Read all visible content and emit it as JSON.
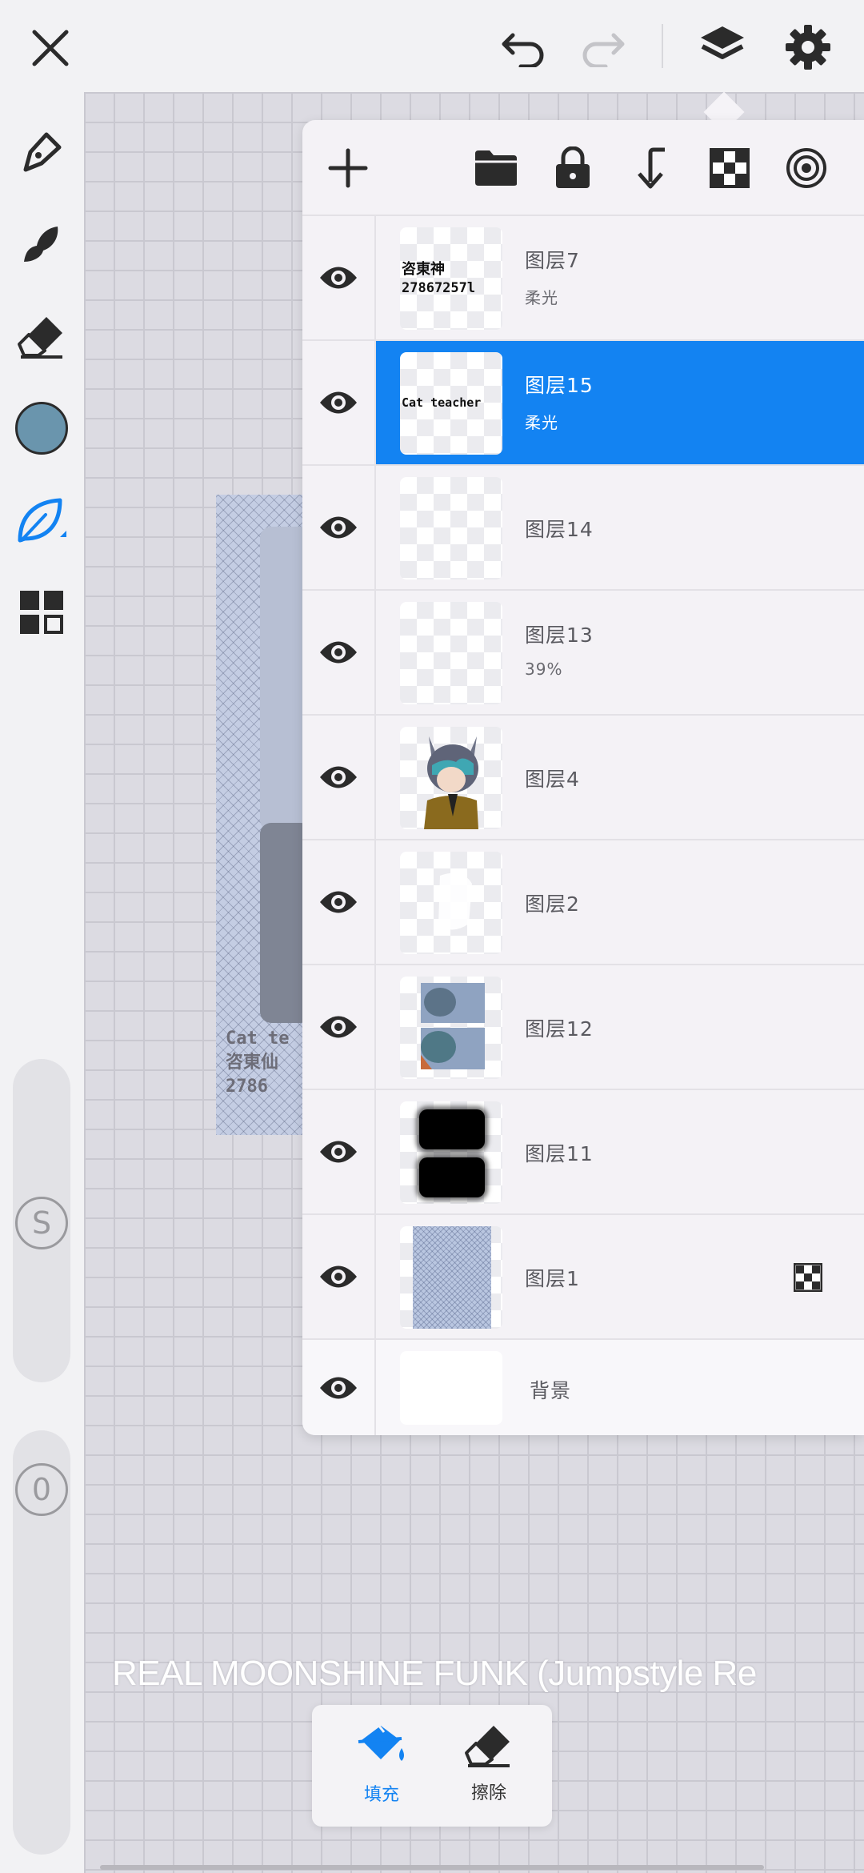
{
  "topbar": {
    "close": {
      "icon": "close-icon"
    },
    "undo": {
      "icon": "undo-icon"
    },
    "redo": {
      "icon": "redo-icon",
      "enabled": false
    },
    "layers": {
      "icon": "layers-icon",
      "active": true
    },
    "settings": {
      "icon": "gear-icon"
    }
  },
  "tools": [
    {
      "name": "pen",
      "icon": "pen-icon"
    },
    {
      "name": "brush",
      "icon": "brush-icon"
    },
    {
      "name": "eraser",
      "icon": "eraser-icon"
    },
    {
      "name": "color",
      "icon": "color-swatch",
      "color": "#6a95ad"
    },
    {
      "name": "fill",
      "icon": "leaf-fill-icon",
      "active": true
    },
    {
      "name": "more",
      "icon": "grid-menu-icon"
    }
  ],
  "sliders": {
    "size_label": "S",
    "opacity_label": "0"
  },
  "canvas_art": {
    "text_line1": "Cat te",
    "text_line2": "咨東仙",
    "text_line3": "2786"
  },
  "layers_toolbar": [
    {
      "icon": "add-icon"
    },
    {
      "icon": "folder-icon"
    },
    {
      "icon": "lock-icon"
    },
    {
      "icon": "merge-down-icon"
    },
    {
      "icon": "checker-icon"
    },
    {
      "icon": "target-icon"
    }
  ],
  "layers": [
    {
      "name": "图层7",
      "sub": "柔光",
      "thumb_text": [
        "咨東神",
        "27867257l"
      ],
      "selected": false
    },
    {
      "name": "图层15",
      "sub": "柔光",
      "thumb_text": [
        "Cat teacher"
      ],
      "selected": true
    },
    {
      "name": "图层14",
      "sub": "",
      "selected": false
    },
    {
      "name": "图层13",
      "sub": "39%",
      "selected": false
    },
    {
      "name": "图层4",
      "sub": "",
      "selected": false
    },
    {
      "name": "图层2",
      "sub": "",
      "selected": false
    },
    {
      "name": "图层12",
      "sub": "",
      "selected": false
    },
    {
      "name": "图层11",
      "sub": "",
      "selected": false
    },
    {
      "name": "图层1",
      "sub": "",
      "selected": false,
      "extra_icon": "checker-icon"
    },
    {
      "name": "背景",
      "sub": "",
      "selected": false
    }
  ],
  "song_title": "REAL MOONSHINE FUNK (Jumpstyle Re",
  "popup": {
    "fill_label": "填充",
    "erase_label": "擦除"
  },
  "colors": {
    "accent": "#1383f2",
    "swatch": "#6a95ad"
  }
}
